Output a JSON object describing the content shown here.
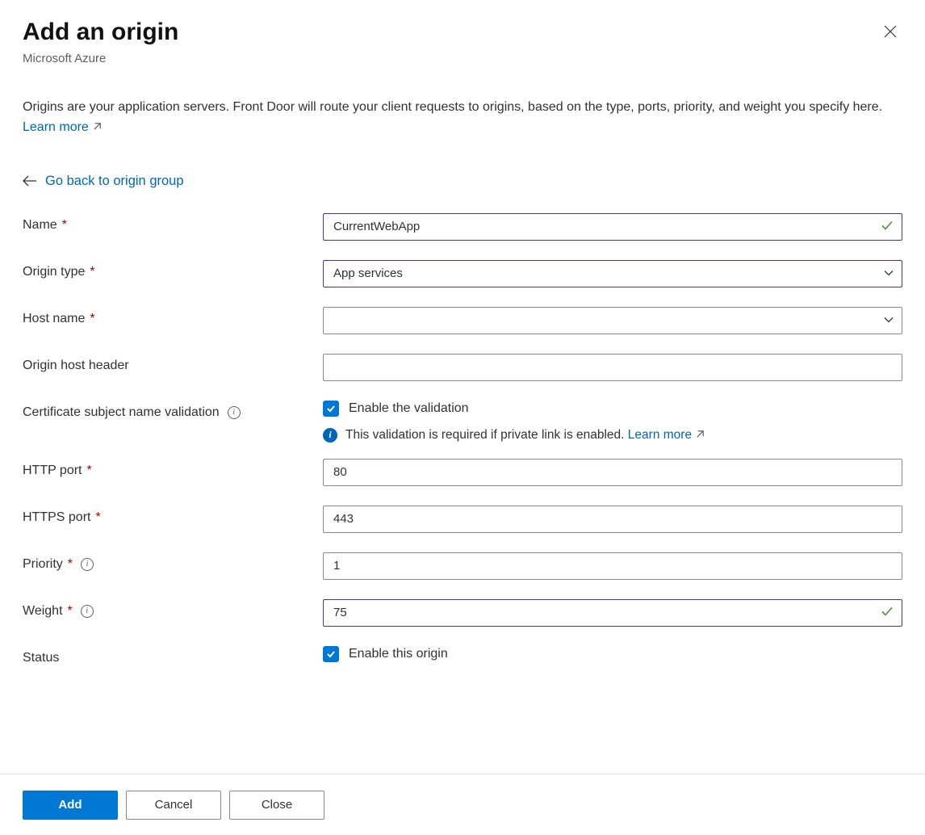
{
  "header": {
    "title": "Add an origin",
    "subtitle": "Microsoft Azure"
  },
  "description": {
    "text": "Origins are your application servers. Front Door will route your client requests to origins, based on the type, ports, priority, and weight you specify here. ",
    "learn_more": "Learn more"
  },
  "back_link": "Go back to origin group",
  "form": {
    "name": {
      "label": "Name",
      "value": "CurrentWebApp",
      "required": true
    },
    "origin_type": {
      "label": "Origin type",
      "value": "App services",
      "required": true
    },
    "host_name": {
      "label": "Host name",
      "value": "",
      "required": true
    },
    "origin_host_header": {
      "label": "Origin host header",
      "value": "",
      "required": false
    },
    "cert_validation": {
      "label": "Certificate subject name validation",
      "checkbox_label": "Enable the validation",
      "checked": true,
      "info_text": "This validation is required if private link is enabled. ",
      "info_link": "Learn more"
    },
    "http_port": {
      "label": "HTTP port",
      "value": "80",
      "required": true
    },
    "https_port": {
      "label": "HTTPS port",
      "value": "443",
      "required": true
    },
    "priority": {
      "label": "Priority",
      "value": "1",
      "required": true
    },
    "weight": {
      "label": "Weight",
      "value": "75",
      "required": true
    },
    "status": {
      "label": "Status",
      "checkbox_label": "Enable this origin",
      "checked": true
    }
  },
  "footer": {
    "add": "Add",
    "cancel": "Cancel",
    "close": "Close"
  }
}
